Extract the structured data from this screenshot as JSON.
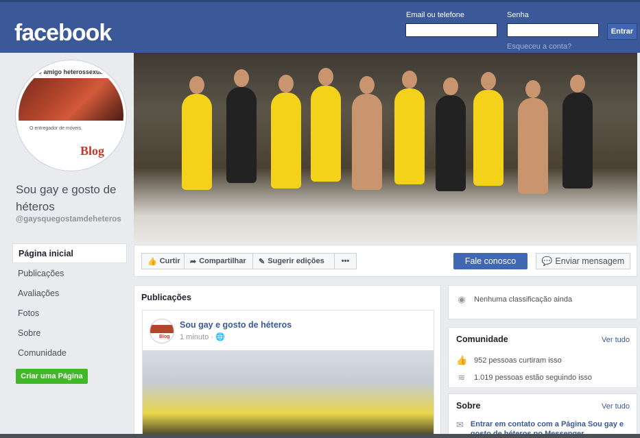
{
  "header": {
    "logo": "facebook",
    "email_label": "Email ou telefone",
    "password_label": "Senha",
    "login_button": "Entrar",
    "forgot_link": "Esqueceu a conta?",
    "colors": {
      "bar": "#3b5998",
      "button": "#4267b2"
    }
  },
  "profile": {
    "avatar_header": "O amigo heterossexual",
    "avatar_caption": "O entregador de móveis.",
    "avatar_brand": "Blog",
    "page_name": "Sou gay e gosto de héteros",
    "handle": "@gaysquegostamdeheteros"
  },
  "nav": {
    "items": [
      "Página inicial",
      "Publicações",
      "Avaliações",
      "Fotos",
      "Sobre",
      "Comunidade"
    ],
    "active": "Página inicial",
    "create_page": "Criar uma Página"
  },
  "actions": {
    "like": "Curtir",
    "share": "Compartilhar",
    "suggest": "Sugerir edições",
    "more": "•••",
    "contact": "Fale conosco",
    "message": "Enviar mensagem"
  },
  "feed": {
    "title": "Publicações",
    "post": {
      "author": "Sou gay e gosto de héteros",
      "time": "1 minuto ·",
      "avatar_brand": "Blog"
    }
  },
  "rating": {
    "text": "Nenhuma classificação ainda"
  },
  "community": {
    "title": "Comunidade",
    "see_all": "Ver tudo",
    "likes": "952 pessoas curtiram isso",
    "follows": "1.019 pessoas estão seguindo isso"
  },
  "about": {
    "title": "Sobre",
    "see_all": "Ver tudo",
    "messenger_text": "Entrar em contato com a Página Sou gay e gosto de héteros no Messenger"
  }
}
